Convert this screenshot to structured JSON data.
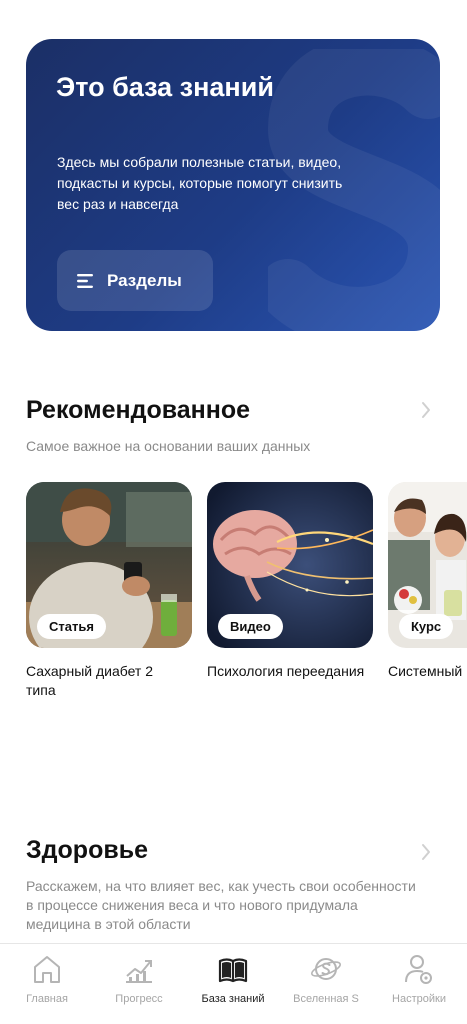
{
  "hero": {
    "title": "Это база знаний",
    "description": "Здесь мы собрали полезные статьи, видео, подкасты и курсы, которые помогут снизить вес раз и навсегда",
    "sections_button": "Разделы"
  },
  "recommended": {
    "title": "Рекомендованное",
    "subtitle": "Самое важное на основании ваших данных",
    "cards": [
      {
        "badge": "Статья",
        "title": "Сахарный диабет 2 типа"
      },
      {
        "badge": "Видео",
        "title": "Психология переедания"
      },
      {
        "badge": "Курс",
        "title": "Системный подход"
      }
    ]
  },
  "health": {
    "title": "Здоровье",
    "subtitle": "Расскажем, на что влияет вес, как учесть свои особенности в процессе снижения веса и что нового придумала медицина в этой области"
  },
  "tabbar": {
    "tabs": [
      {
        "label": "Главная",
        "icon": "home-icon"
      },
      {
        "label": "Прогресс",
        "icon": "progress-chart-icon"
      },
      {
        "label": "База знаний",
        "icon": "book-icon"
      },
      {
        "label": "Вселенная S",
        "icon": "planet-s-icon"
      },
      {
        "label": "Настройки",
        "icon": "settings-user-icon"
      }
    ],
    "active_index": 2
  },
  "colors": {
    "hero_bg": "#1e3c86",
    "active_tab": "#222222",
    "inactive_tab": "#a5a5a5"
  }
}
